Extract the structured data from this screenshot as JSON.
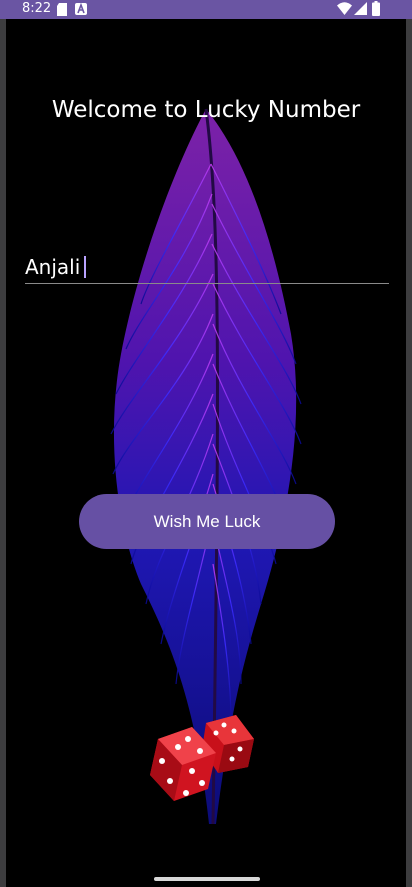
{
  "status_bar": {
    "time": "8:22",
    "icons": [
      "sd-card-icon",
      "notification-a-icon",
      "wifi-icon",
      "signal-icon",
      "battery-icon"
    ],
    "color": "#6a55a3"
  },
  "screen": {
    "title": "Welcome to Lucky Number",
    "name_input": {
      "value": "Anjali"
    },
    "wish_button": {
      "label": "Wish Me Luck",
      "color": "#6650a4"
    },
    "background_color": "#000000"
  }
}
